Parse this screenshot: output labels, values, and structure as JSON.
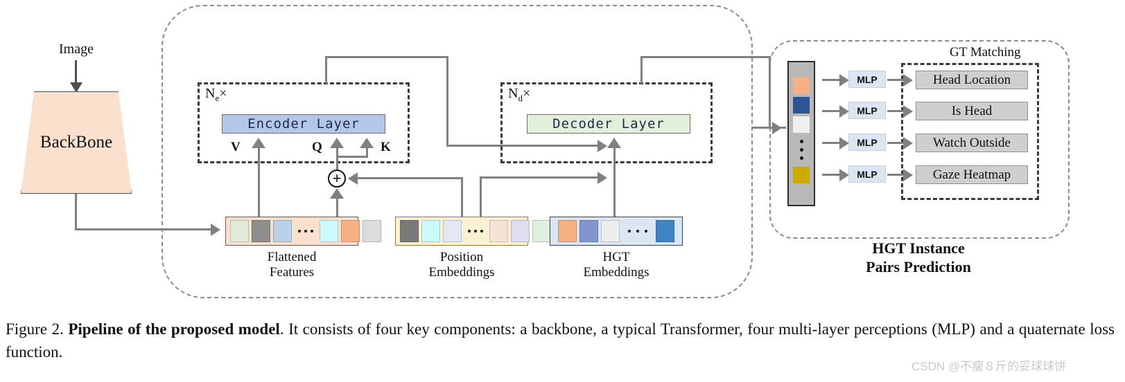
{
  "figure": {
    "input_label": "Image",
    "backbone_label": "BackBone",
    "encoder": {
      "repeat_label": "Ne×",
      "repeat_base": "N",
      "repeat_sub": "e",
      "repeat_suffix": "×",
      "box_label": "Encoder Layer",
      "box_color": "#b4c7e7",
      "inputs": [
        "V",
        "Q",
        "K"
      ]
    },
    "decoder": {
      "repeat_label": "Nd×",
      "repeat_base": "N",
      "repeat_sub": "d",
      "repeat_suffix": "×",
      "box_label": "Decoder Layer",
      "box_color": "#e2efda"
    },
    "add_symbol": "+",
    "strips": [
      {
        "name": "flattened-features",
        "caption_line1": "Flattened",
        "caption_line2": "Features",
        "fill": "#fae0cd",
        "border": "#5d5d5d",
        "cells_left": [
          "#dfead8",
          "#8f8f8f",
          "#bcd0e8"
        ],
        "cells_right": [
          "#ccfafc",
          "#f5b183",
          "#dcdcdc"
        ]
      },
      {
        "name": "position-embeddings",
        "caption_line1": "Position",
        "caption_line2": "Embeddings",
        "fill": "#fdf1d4",
        "border": "#8c7b3d",
        "cells_left": [
          "#7a7a7a",
          "#ccfafc",
          "#e2e8f4"
        ],
        "cells_right": [
          "#f7e2d6",
          "#dedef0",
          "#dff0e0"
        ]
      },
      {
        "name": "hgt-embeddings",
        "caption_line1": "HGT",
        "caption_line2": "Embeddings",
        "fill": "#dce6f2",
        "border": "#31455c",
        "cells_left": [
          "#f5b183",
          "#8195d0",
          "#eeeeee"
        ],
        "cells_right": [
          "#3f84c4"
        ]
      }
    ],
    "prediction": {
      "gt_matching_label": "GT Matching",
      "title_line1": "HGT Instance",
      "title_line2": "Pairs Prediction",
      "token_bar": {
        "fill": "#b8b8b8",
        "cells": [
          "#f5b183",
          "#2f5496",
          "#efefef"
        ],
        "last_cell": "#ccaa00"
      },
      "rows": [
        {
          "mlp_label": "MLP",
          "output_label": "Head Location"
        },
        {
          "mlp_label": "MLP",
          "output_label": "Is Head"
        },
        {
          "mlp_label": "MLP",
          "output_label": "Watch Outside"
        },
        {
          "mlp_label": "MLP",
          "output_label": "Gaze Heatmap"
        }
      ]
    }
  },
  "caption": {
    "figure_number": "Figure 2.",
    "bold_title": "Pipeline of the proposed model",
    "body": ". It consists of four key components: a backbone, a typical Transformer, four multi-layer perceptions (MLP) and a quaternate loss function.",
    "watermark": "CSDN @不瘦８斤的妥球球饼"
  }
}
